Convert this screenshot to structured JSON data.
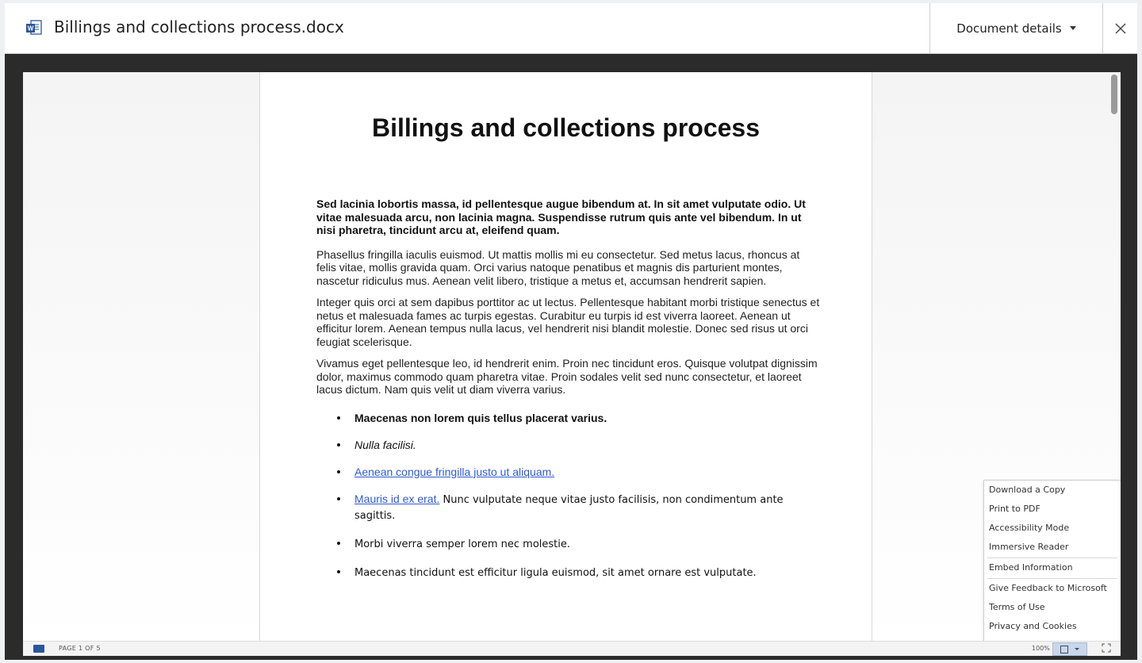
{
  "header": {
    "title": "Billings and collections process.docx",
    "details_label": "Document details",
    "file_icon": "word-file-icon",
    "close_icon": "close-icon"
  },
  "document": {
    "title": "Billings and collections process",
    "paragraphs": [
      "Sed lacinia lobortis massa, id pellentesque augue bibendum at. In sit amet vulputate odio. Ut vitae malesuada arcu, non lacinia magna. Suspendisse rutrum quis ante vel bibendum. In ut nisi pharetra, tincidunt arcu at, eleifend quam.",
      "Phasellus fringilla iaculis euismod. Ut mattis mollis mi eu consectetur. Sed metus lacus, rhoncus at felis vitae, mollis gravida quam. Orci varius natoque penatibus et magnis dis parturient montes, nascetur ridiculus mus. Aenean velit libero, tristique a metus et, accumsan hendrerit sapien.",
      "Integer quis orci at sem dapibus porttitor ac ut lectus. Pellentesque habitant morbi tristique senectus et netus et malesuada fames ac turpis egestas. Curabitur eu turpis id est viverra laoreet. Aenean ut efficitur lorem. Aenean tempus nulla lacus, vel hendrerit nisi blandit molestie. Donec sed risus ut orci feugiat scelerisque.",
      "Vivamus eget pellentesque leo, id hendrerit enim. Proin nec tincidunt eros. Quisque volutpat dignissim dolor, maximus commodo quam pharetra vitae. Proin sodales velit sed nunc consectetur, et laoreet lacus dictum. Nam quis velit ut diam viverra varius."
    ],
    "bullets": {
      "b1": "Maecenas non lorem quis tellus placerat varius.",
      "b2": "Nulla facilisi.",
      "b3_link": "Aenean congue fringilla justo ut aliquam.",
      "b4_link": "Mauris id ex erat.",
      "b4_text": " Nunc vulputate neque vitae justo facilisis, non condimentum ante sagittis.",
      "b5": "Morbi viverra semper lorem nec molestie.",
      "b6": "Maecenas tincidunt est efficitur ligula euismod, sit amet ornare est vulputate."
    }
  },
  "menu": {
    "download": "Download a Copy",
    "print": "Print to PDF",
    "accessibility": "Accessibility Mode",
    "immersive": "Immersive Reader",
    "embed": "Embed Information",
    "feedback": "Give Feedback to Microsoft",
    "terms": "Terms of Use",
    "privacy": "Privacy and Cookies"
  },
  "statusbar": {
    "page_info": "PAGE 1 OF 5",
    "zoom": "100%"
  },
  "colors": {
    "link": "#2e5bd6",
    "viewer_bg": "#2b2b2b",
    "word_blue": "#2b579a"
  }
}
